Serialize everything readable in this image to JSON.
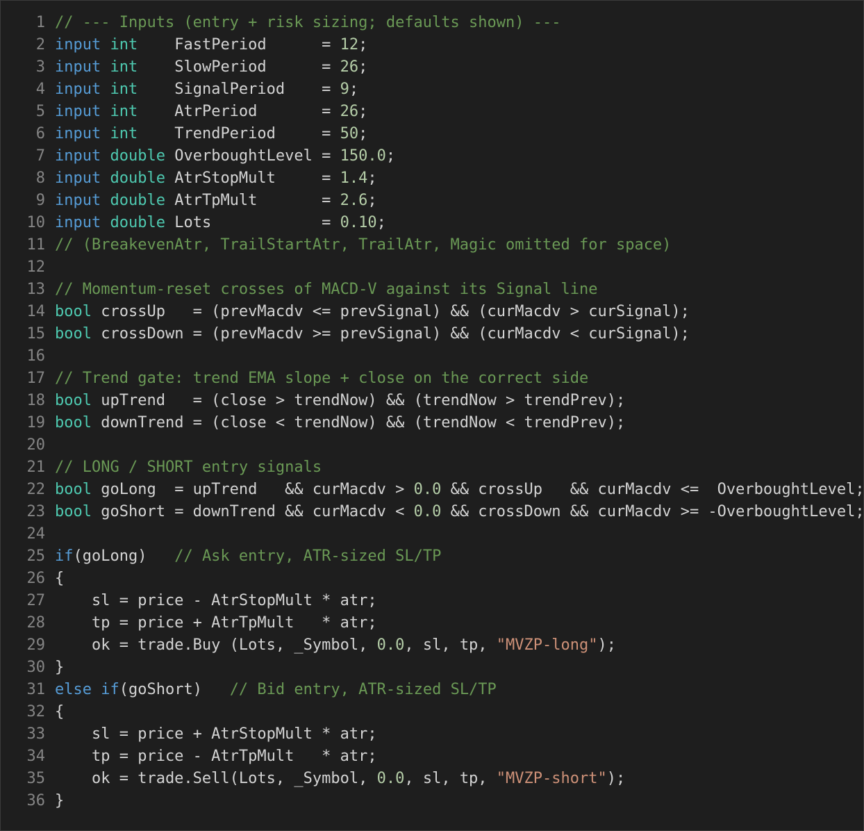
{
  "editor": {
    "language": "MQL5",
    "colors": {
      "background": "#1e1e1e",
      "line_number": "#858585",
      "keyword": "#569cd6",
      "type": "#4ec9b0",
      "comment": "#6a9955",
      "number": "#b5cea8",
      "string": "#ce9178",
      "text": "#d4d4d4"
    },
    "lines": [
      {
        "n": "1",
        "tokens": [
          {
            "t": "cm",
            "v": "// --- Inputs (entry + risk sizing; defaults shown) ---"
          }
        ]
      },
      {
        "n": "2",
        "tokens": [
          {
            "t": "kw",
            "v": "input"
          },
          {
            "t": "plain",
            "v": " "
          },
          {
            "t": "type",
            "v": "int"
          },
          {
            "t": "plain",
            "v": "    FastPeriod      = "
          },
          {
            "t": "num",
            "v": "12"
          },
          {
            "t": "plain",
            "v": ";"
          }
        ]
      },
      {
        "n": "3",
        "tokens": [
          {
            "t": "kw",
            "v": "input"
          },
          {
            "t": "plain",
            "v": " "
          },
          {
            "t": "type",
            "v": "int"
          },
          {
            "t": "plain",
            "v": "    SlowPeriod      = "
          },
          {
            "t": "num",
            "v": "26"
          },
          {
            "t": "plain",
            "v": ";"
          }
        ]
      },
      {
        "n": "4",
        "tokens": [
          {
            "t": "kw",
            "v": "input"
          },
          {
            "t": "plain",
            "v": " "
          },
          {
            "t": "type",
            "v": "int"
          },
          {
            "t": "plain",
            "v": "    SignalPeriod    = "
          },
          {
            "t": "num",
            "v": "9"
          },
          {
            "t": "plain",
            "v": ";"
          }
        ]
      },
      {
        "n": "5",
        "tokens": [
          {
            "t": "kw",
            "v": "input"
          },
          {
            "t": "plain",
            "v": " "
          },
          {
            "t": "type",
            "v": "int"
          },
          {
            "t": "plain",
            "v": "    AtrPeriod       = "
          },
          {
            "t": "num",
            "v": "26"
          },
          {
            "t": "plain",
            "v": ";"
          }
        ]
      },
      {
        "n": "6",
        "tokens": [
          {
            "t": "kw",
            "v": "input"
          },
          {
            "t": "plain",
            "v": " "
          },
          {
            "t": "type",
            "v": "int"
          },
          {
            "t": "plain",
            "v": "    TrendPeriod     = "
          },
          {
            "t": "num",
            "v": "50"
          },
          {
            "t": "plain",
            "v": ";"
          }
        ]
      },
      {
        "n": "7",
        "tokens": [
          {
            "t": "kw",
            "v": "input"
          },
          {
            "t": "plain",
            "v": " "
          },
          {
            "t": "type",
            "v": "double"
          },
          {
            "t": "plain",
            "v": " OverboughtLevel = "
          },
          {
            "t": "num",
            "v": "150.0"
          },
          {
            "t": "plain",
            "v": ";"
          }
        ]
      },
      {
        "n": "8",
        "tokens": [
          {
            "t": "kw",
            "v": "input"
          },
          {
            "t": "plain",
            "v": " "
          },
          {
            "t": "type",
            "v": "double"
          },
          {
            "t": "plain",
            "v": " AtrStopMult     = "
          },
          {
            "t": "num",
            "v": "1.4"
          },
          {
            "t": "plain",
            "v": ";"
          }
        ]
      },
      {
        "n": "9",
        "tokens": [
          {
            "t": "kw",
            "v": "input"
          },
          {
            "t": "plain",
            "v": " "
          },
          {
            "t": "type",
            "v": "double"
          },
          {
            "t": "plain",
            "v": " AtrTpMult       = "
          },
          {
            "t": "num",
            "v": "2.6"
          },
          {
            "t": "plain",
            "v": ";"
          }
        ]
      },
      {
        "n": "10",
        "tokens": [
          {
            "t": "kw",
            "v": "input"
          },
          {
            "t": "plain",
            "v": " "
          },
          {
            "t": "type",
            "v": "double"
          },
          {
            "t": "plain",
            "v": " Lots            = "
          },
          {
            "t": "num",
            "v": "0.10"
          },
          {
            "t": "plain",
            "v": ";"
          }
        ]
      },
      {
        "n": "11",
        "tokens": [
          {
            "t": "cm",
            "v": "// (BreakevenAtr, TrailStartAtr, TrailAtr, Magic omitted for space)"
          }
        ]
      },
      {
        "n": "12",
        "tokens": []
      },
      {
        "n": "13",
        "tokens": [
          {
            "t": "cm",
            "v": "// Momentum-reset crosses of MACD-V against its Signal line"
          }
        ]
      },
      {
        "n": "14",
        "tokens": [
          {
            "t": "type",
            "v": "bool"
          },
          {
            "t": "plain",
            "v": " crossUp   = (prevMacdv <= prevSignal) && (curMacdv > curSignal);"
          }
        ]
      },
      {
        "n": "15",
        "tokens": [
          {
            "t": "type",
            "v": "bool"
          },
          {
            "t": "plain",
            "v": " crossDown = (prevMacdv >= prevSignal) && (curMacdv < curSignal);"
          }
        ]
      },
      {
        "n": "16",
        "tokens": []
      },
      {
        "n": "17",
        "tokens": [
          {
            "t": "cm",
            "v": "// Trend gate: trend EMA slope + close on the correct side"
          }
        ]
      },
      {
        "n": "18",
        "tokens": [
          {
            "t": "type",
            "v": "bool"
          },
          {
            "t": "plain",
            "v": " upTrend   = (close > trendNow) && (trendNow > trendPrev);"
          }
        ]
      },
      {
        "n": "19",
        "tokens": [
          {
            "t": "type",
            "v": "bool"
          },
          {
            "t": "plain",
            "v": " downTrend = (close < trendNow) && (trendNow < trendPrev);"
          }
        ]
      },
      {
        "n": "20",
        "tokens": []
      },
      {
        "n": "21",
        "tokens": [
          {
            "t": "cm",
            "v": "// LONG / SHORT entry signals"
          }
        ]
      },
      {
        "n": "22",
        "tokens": [
          {
            "t": "type",
            "v": "bool"
          },
          {
            "t": "plain",
            "v": " goLong  = upTrend   && curMacdv > "
          },
          {
            "t": "num",
            "v": "0.0"
          },
          {
            "t": "plain",
            "v": " && crossUp   && curMacdv <=  OverboughtLevel;"
          }
        ]
      },
      {
        "n": "23",
        "tokens": [
          {
            "t": "type",
            "v": "bool"
          },
          {
            "t": "plain",
            "v": " goShort = downTrend && curMacdv < "
          },
          {
            "t": "num",
            "v": "0.0"
          },
          {
            "t": "plain",
            "v": " && crossDown && curMacdv >= -OverboughtLevel;"
          }
        ]
      },
      {
        "n": "24",
        "tokens": []
      },
      {
        "n": "25",
        "tokens": [
          {
            "t": "kw",
            "v": "if"
          },
          {
            "t": "plain",
            "v": "(goLong)   "
          },
          {
            "t": "cm",
            "v": "// Ask entry, ATR-sized SL/TP"
          }
        ]
      },
      {
        "n": "26",
        "tokens": [
          {
            "t": "plain",
            "v": "{"
          }
        ]
      },
      {
        "n": "27",
        "tokens": [
          {
            "t": "plain",
            "v": "    sl = price - AtrStopMult * atr;"
          }
        ]
      },
      {
        "n": "28",
        "tokens": [
          {
            "t": "plain",
            "v": "    tp = price + AtrTpMult   * atr;"
          }
        ]
      },
      {
        "n": "29",
        "tokens": [
          {
            "t": "plain",
            "v": "    ok = trade.Buy (Lots, _Symbol, "
          },
          {
            "t": "num",
            "v": "0.0"
          },
          {
            "t": "plain",
            "v": ", sl, tp, "
          },
          {
            "t": "str",
            "v": "\"MVZP-long\""
          },
          {
            "t": "plain",
            "v": ");"
          }
        ]
      },
      {
        "n": "30",
        "tokens": [
          {
            "t": "plain",
            "v": "}"
          }
        ]
      },
      {
        "n": "31",
        "tokens": [
          {
            "t": "kw",
            "v": "else"
          },
          {
            "t": "plain",
            "v": " "
          },
          {
            "t": "kw",
            "v": "if"
          },
          {
            "t": "plain",
            "v": "(goShort)   "
          },
          {
            "t": "cm",
            "v": "// Bid entry, ATR-sized SL/TP"
          }
        ]
      },
      {
        "n": "32",
        "tokens": [
          {
            "t": "plain",
            "v": "{"
          }
        ]
      },
      {
        "n": "33",
        "tokens": [
          {
            "t": "plain",
            "v": "    sl = price + AtrStopMult * atr;"
          }
        ]
      },
      {
        "n": "34",
        "tokens": [
          {
            "t": "plain",
            "v": "    tp = price - AtrTpMult   * atr;"
          }
        ]
      },
      {
        "n": "35",
        "tokens": [
          {
            "t": "plain",
            "v": "    ok = trade.Sell(Lots, _Symbol, "
          },
          {
            "t": "num",
            "v": "0.0"
          },
          {
            "t": "plain",
            "v": ", sl, tp, "
          },
          {
            "t": "str",
            "v": "\"MVZP-short\""
          },
          {
            "t": "plain",
            "v": ");"
          }
        ]
      },
      {
        "n": "36",
        "tokens": [
          {
            "t": "plain",
            "v": "}"
          }
        ]
      }
    ]
  }
}
